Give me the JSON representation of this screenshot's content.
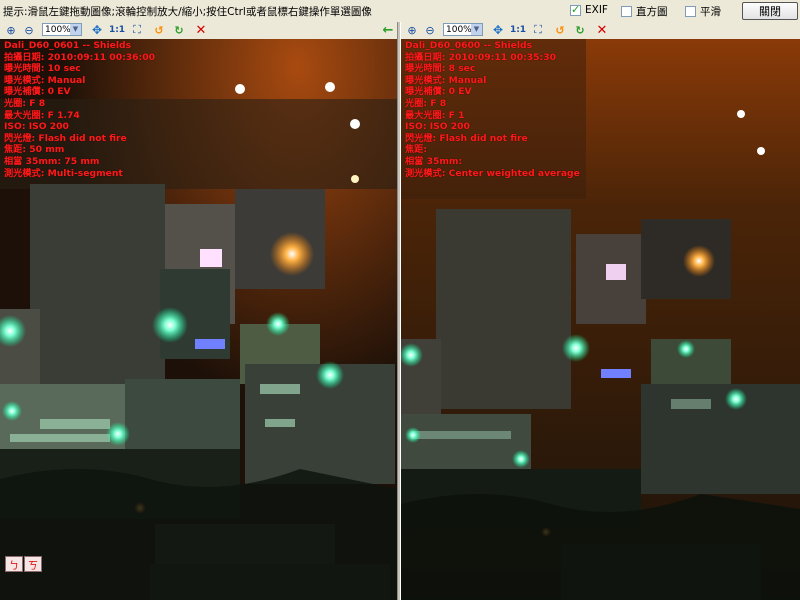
{
  "hint": "提示:滑鼠左鍵拖動圖像;滾輪控制放大/縮小;按住Ctrl或者鼠標右鍵操作單選圖像",
  "options": {
    "exif": {
      "label": "EXIF",
      "checked": true
    },
    "histogram": {
      "label": "直方圖",
      "checked": false
    },
    "smooth": {
      "label": "平滑",
      "checked": false
    }
  },
  "close_label": "關閉",
  "left_pane": {
    "zoom": "100%",
    "orig_label": "1:1",
    "exif": [
      "Dali_D60_0601 -- Shields",
      "拍攝日期: 2010:09:11 00:36:00",
      "曝光時間: 10 sec",
      "曝光模式: Manual",
      "曝光補償: 0 EV",
      "光圈: F 8",
      "最大光圈: F 1.74",
      "ISO: ISO 200",
      "閃光燈: Flash did not fire",
      "焦距: 50 mm",
      "相當 35mm: 75 mm",
      "測光模式: Multi-segment"
    ],
    "mini_buttons": [
      "ㄅ",
      "ㄎ"
    ]
  },
  "right_pane": {
    "zoom": "100%",
    "orig_label": "1:1",
    "exif": [
      "Dali_D60_0600 -- Shields",
      "拍攝日期: 2010:09:11 00:35:30",
      "曝光時間: 8 sec",
      "曝光模式: Manual",
      "曝光補償: 0 EV",
      "光圈: F 8",
      "最大光圈: F 1",
      "ISO: ISO 200",
      "閃光燈: Flash did not fire",
      "焦距:",
      "相當 35mm:",
      "測光模式: Center weighted average"
    ]
  },
  "colors": {
    "exif_text": "#ff1a1a",
    "chrome": "#ece9d8",
    "night_sky": "#2a1606",
    "green_light": "#40ffb0"
  }
}
